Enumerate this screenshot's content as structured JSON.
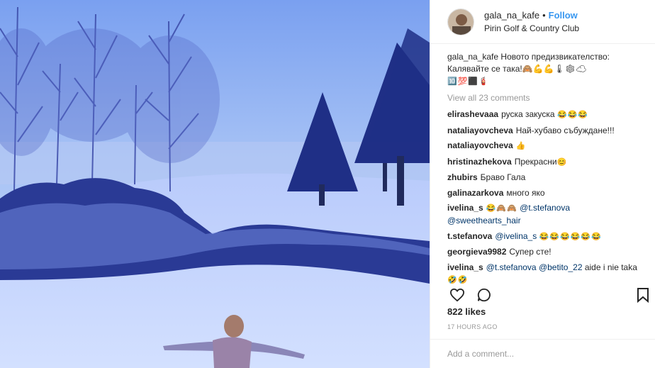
{
  "post": {
    "username": "gala_na_kafe",
    "separator": "•",
    "follow_label": "Follow",
    "location": "Pirin Golf & Country Club"
  },
  "caption": {
    "username": "gala_na_kafe",
    "text": "Новото предизвикателство: Калявайте се така!🙈💪💪🌡❄☁",
    "emoji_line": "🔟💯⬛🧯"
  },
  "view_all_label": "View all 23 comments",
  "comments": [
    {
      "user": "elirashevaaa",
      "text": "руска закуска",
      "emoji": "😂😂😂"
    },
    {
      "user": "nataliayovcheva",
      "text": "Най-хубаво събуждане!!!",
      "emoji": ""
    },
    {
      "user": "nataliayovcheva",
      "text": "",
      "emoji": "👍"
    },
    {
      "user": "hristinazhekova",
      "text": "Прекрасни",
      "emoji": "😊"
    },
    {
      "user": "zhubirs",
      "text": "Браво Гала",
      "emoji": ""
    },
    {
      "user": "galinazarkova",
      "text": "много яко",
      "emoji": ""
    },
    {
      "user": "ivelina_s",
      "text": "",
      "emoji": "😂🙈🙈",
      "mention": "@t.stefanova",
      "mention2": "@sweethearts_hair"
    },
    {
      "user": "t.stefanova",
      "text": "",
      "mention": "@ivelina_s",
      "emoji": "😂😂😂😂😂😂"
    },
    {
      "user": "georgieva9982",
      "text": "Супер сте!",
      "emoji": ""
    },
    {
      "user": "ivelina_s",
      "mention": "@t.stefanova",
      "mention2": "@betito_22",
      "text": "aide i nie taka",
      "emoji": "🤣🤣"
    }
  ],
  "likes": "822 likes",
  "time_ago": "17 HOURS AGO",
  "add_comment_placeholder": "Add a comment...",
  "icons": {
    "like": "heart-icon",
    "comment": "comment-icon",
    "save": "bookmark-icon"
  },
  "colors": {
    "follow": "#3897f0",
    "mention": "#003569",
    "muted": "#999999"
  }
}
